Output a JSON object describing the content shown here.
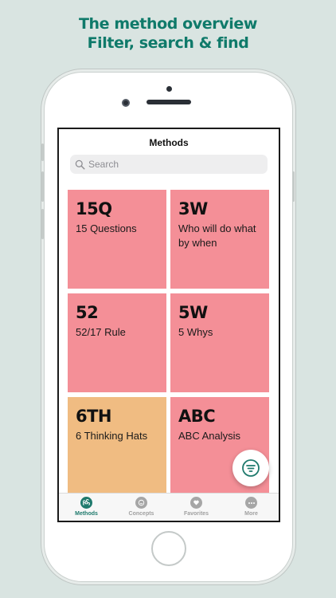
{
  "marketing": {
    "line1": "The method overview",
    "line2": "Filter, search & find"
  },
  "colors": {
    "accent": "#1f7a6d",
    "card_pink": "#f48f97",
    "card_orange": "#f0bc82"
  },
  "nav": {
    "title": "Methods"
  },
  "search": {
    "placeholder": "Search",
    "icon": "magnifier-icon"
  },
  "methods": [
    {
      "code": "15Q",
      "name": "15 Questions",
      "color": "#f48f97"
    },
    {
      "code": "3W",
      "name": "Who will do what by when",
      "color": "#f48f97"
    },
    {
      "code": "52",
      "name": "52/17 Rule",
      "color": "#f48f97"
    },
    {
      "code": "5W",
      "name": "5 Whys",
      "color": "#f48f97"
    },
    {
      "code": "6TH",
      "name": "6 Thinking Hats",
      "color": "#f0bc82"
    },
    {
      "code": "ABC",
      "name": "ABC Analysis",
      "color": "#f48f97"
    }
  ],
  "fab": {
    "icon": "filter-icon"
  },
  "tabs": [
    {
      "label": "Methods",
      "icon": "command-icon",
      "active": true
    },
    {
      "label": "Concepts",
      "icon": "face-icon",
      "active": false
    },
    {
      "label": "Favorites",
      "icon": "heart-icon",
      "active": false
    },
    {
      "label": "More",
      "icon": "more-icon",
      "active": false
    }
  ]
}
